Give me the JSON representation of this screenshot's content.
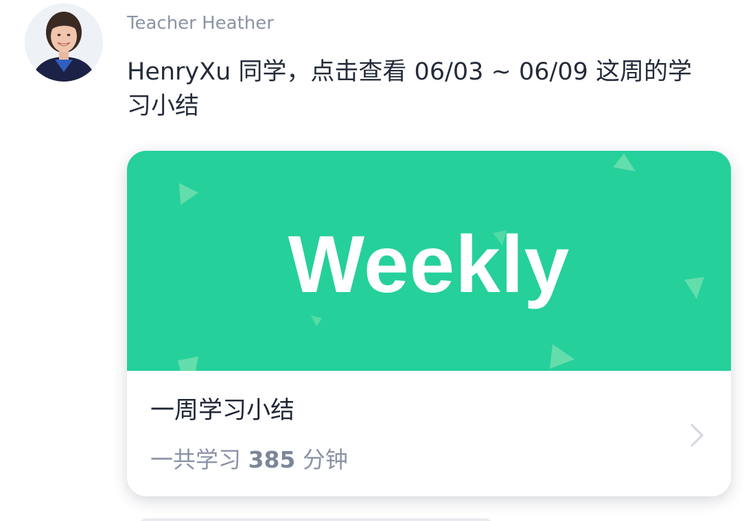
{
  "message": {
    "sender": "Teacher Heather",
    "text": "HenryXu 同学，点击查看 06/03 ~ 06/09 这周的学\n习小结"
  },
  "card": {
    "banner_text": "Weekly",
    "banner_color": "#25d09b",
    "title": "一周学习小结",
    "subtitle_prefix": "一共学习",
    "minutes": "385",
    "subtitle_suffix": "分钟"
  },
  "icons": {
    "avatar": "teacher-avatar",
    "chevron": "chevron-right-icon"
  }
}
